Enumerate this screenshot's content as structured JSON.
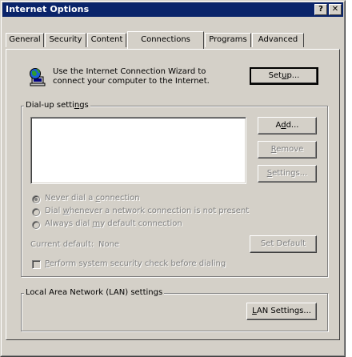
{
  "window": {
    "title": "Internet Options"
  },
  "titlebar_buttons": {
    "help": "?",
    "close": "✕"
  },
  "tabs": [
    {
      "label": "General"
    },
    {
      "label": "Security"
    },
    {
      "label": "Content"
    },
    {
      "label": "Connections"
    },
    {
      "label": "Programs"
    },
    {
      "label": "Advanced"
    }
  ],
  "active_tab": "Connections",
  "wizard": {
    "line1": "Use the Internet Connection Wizard to",
    "line2": "connect your computer to the Internet.",
    "setup_button": {
      "pre": "Set",
      "ul": "u",
      "post": "p..."
    }
  },
  "dialup": {
    "group_label": {
      "pre": "Dial-up setti",
      "ul": "n",
      "post": "gs"
    },
    "add_button": {
      "pre": "A",
      "ul": "d",
      "post": "d..."
    },
    "remove_button": {
      "pre": "",
      "ul": "R",
      "post": "emove"
    },
    "settings_button": {
      "pre": "",
      "ul": "S",
      "post": "ettings..."
    },
    "options": [
      {
        "pre": "Never dial a ",
        "ul": "c",
        "post": "onnection",
        "checked": true
      },
      {
        "pre": "Dial ",
        "ul": "w",
        "post": "henever a network connection is not present",
        "checked": false
      },
      {
        "pre": "Always dial ",
        "ul": "m",
        "post": "y default connection",
        "checked": false
      }
    ],
    "current_default_label": "Current default:",
    "current_default_value": "None",
    "set_default_button": "Set Default",
    "security_check": {
      "pre": "",
      "ul": "P",
      "post": "erform system security check before dialing",
      "checked": false
    }
  },
  "lan": {
    "group_label": "Local Area Network (LAN) settings",
    "lan_button": {
      "pre": "",
      "ul": "L",
      "post": "AN Settings..."
    }
  },
  "colors": {
    "face": "#d4d0c8",
    "title_bg": "#0a246a",
    "disabled_text": "#808080"
  },
  "icons": {
    "wizard": "globe-computer-icon"
  }
}
